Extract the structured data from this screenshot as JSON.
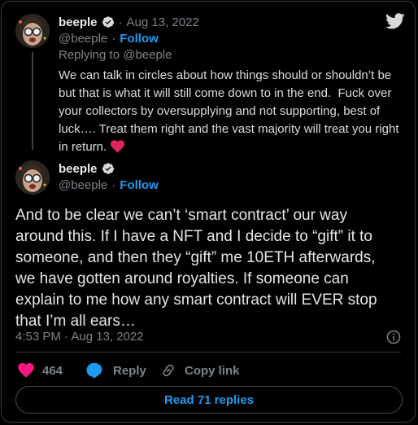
{
  "reply_tweet": {
    "name": "beeple",
    "date": "Aug 13, 2022",
    "separator": "·",
    "handle": "@beeple",
    "follow": "Follow",
    "replying_to": "Replying to @beeple",
    "text": "We can talk in circles about how things should or shouldn’t be but that is what it will still come down to in the end.  Fuck over your collectors by oversupplying and not supporting, best of luck…. Treat them right and the vast majority will treat you right in return."
  },
  "main_tweet": {
    "name": "beeple",
    "handle": "@beeple",
    "follow": "Follow",
    "separator": "·",
    "text": "And to be clear we can’t ‘smart contract’ our way around this. If I have a  NFT and I decide to “gift” it to someone, and then they “gift” me 10ETH afterwards, we have gotten around royalties. If someone can explain to me how any smart contract will EVER stop that I’m all ears…",
    "timestamp": "4:53 PM · Aug 13, 2022"
  },
  "actions": {
    "likes": "464",
    "reply": "Reply",
    "copy_link": "Copy link"
  },
  "read_replies": "Read 71 replies",
  "colors": {
    "accent": "#1d9bf0",
    "like": "#f91880",
    "heart_emoji": "#e0245e",
    "background": "#000000"
  },
  "icons": [
    "twitter-bird-icon",
    "verified-badge-icon",
    "heart-icon",
    "reply-bubble-icon",
    "link-icon",
    "info-icon"
  ]
}
